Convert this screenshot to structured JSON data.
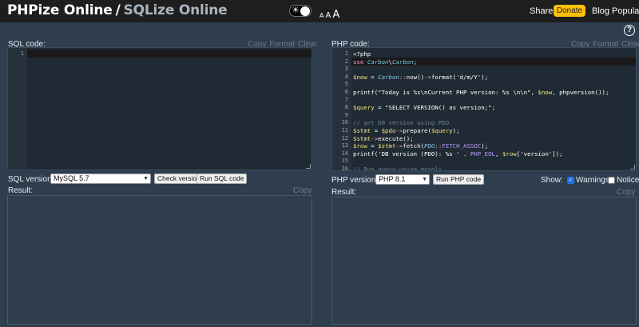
{
  "header": {
    "brand_primary": "PHPize Online",
    "brand_separator": "/",
    "brand_secondary": "SQLize Online",
    "font_sizes": [
      "A",
      "A",
      "A"
    ],
    "share_label": "Share",
    "donate_label": "Donate",
    "blog_label": "Blog",
    "popular_label": "Popular",
    "accent_color": "#ffc107"
  },
  "help_label": "?",
  "sql_panel": {
    "title": "SQL code:",
    "tools": [
      "Copy",
      "Format",
      "Clear"
    ],
    "line_numbers": [
      "1"
    ],
    "version_label": "SQL version:",
    "version_value": "MySQL 5.7",
    "check_button": "Check version",
    "run_button": "Run SQL code",
    "result_label": "Result:",
    "result_copy": "Copy"
  },
  "php_panel": {
    "title": "PHP code:",
    "tools": [
      "Copy",
      "Format",
      "Clear"
    ],
    "line_numbers": [
      "1",
      "2",
      "3",
      "4",
      "5",
      "6",
      "7",
      "8",
      "9",
      "10",
      "11",
      "12",
      "13",
      "14",
      "15",
      "16"
    ],
    "code_lines": [
      "<?php",
      "use Carbon\\Carbon;",
      "",
      "$now = Carbon::now()->format('d/m/Y');",
      "",
      "printf(\"Today is %s\\nCurrent PHP version: %s \\n\\n\", $now, phpversion());",
      "",
      "$query = \"SELECT VERSION() as version;\";",
      "",
      "// get DB version using PDO",
      "$stmt = $pdo->prepare($query);",
      "$stmt->execute();",
      "$row = $stmt->fetch(PDO::FETCH_ASSOC);",
      "printf('DB version (PDO): %s ' . PHP_EOL, $row['version']);",
      "",
      "// Run query using mysqli"
    ],
    "version_label": "PHP version:",
    "version_value": "PHP 8.1",
    "run_button": "Run PHP code",
    "show_label": "Show:",
    "warnings_label": "Warnings",
    "warnings_checked": true,
    "notice_label": "Notice",
    "notice_checked": false,
    "result_label": "Result:",
    "result_copy": "Copy"
  }
}
